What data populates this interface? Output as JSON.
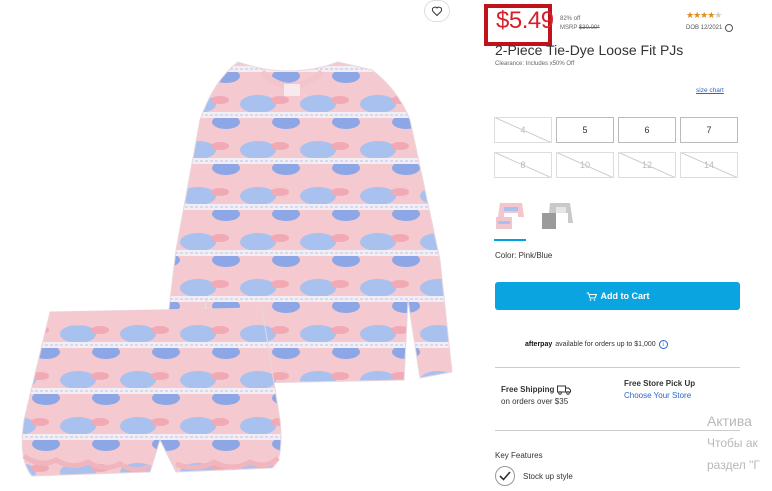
{
  "product": {
    "price": "$5.49",
    "discount": "82% off",
    "msrp_label": "MSRP",
    "msrp_value": "$30.00*",
    "rating_stars": "★★★★",
    "rating_empty": "★",
    "dob": "DOB 12/2021",
    "title": "2-Piece Tie-Dye Loose Fit PJs",
    "clearance": "Clearance: Includes x50% Off",
    "size_chart": "size chart"
  },
  "sizes": [
    {
      "label": "4",
      "available": false
    },
    {
      "label": "5",
      "available": true
    },
    {
      "label": "6",
      "available": true
    },
    {
      "label": "7",
      "available": true
    },
    {
      "label": "8",
      "available": false
    },
    {
      "label": "10",
      "available": false
    },
    {
      "label": "12",
      "available": false
    },
    {
      "label": "14",
      "available": false
    }
  ],
  "color": {
    "label": "Color: Pink/Blue"
  },
  "cart": {
    "add_label": "Add to Cart"
  },
  "afterpay": {
    "brand": "afterpay",
    "text": "available for orders up to $1,000"
  },
  "shipping": {
    "free_shipping": "Free Shipping",
    "threshold": "on orders over $35",
    "pickup": "Free Store Pick Up",
    "choose_store": "Choose Your Store"
  },
  "features": {
    "heading": "Key Features",
    "item": "Stock up style"
  },
  "watermark": {
    "line1": "Актива",
    "line2": "Чтобы ак",
    "line3": "раздел \"Г"
  },
  "colors": {
    "price_red": "#d81f2a",
    "highlight_box": "#c0121a",
    "cart_blue": "#0aa4e0",
    "link_blue": "#2a66c9",
    "star": "#e38a1b"
  }
}
